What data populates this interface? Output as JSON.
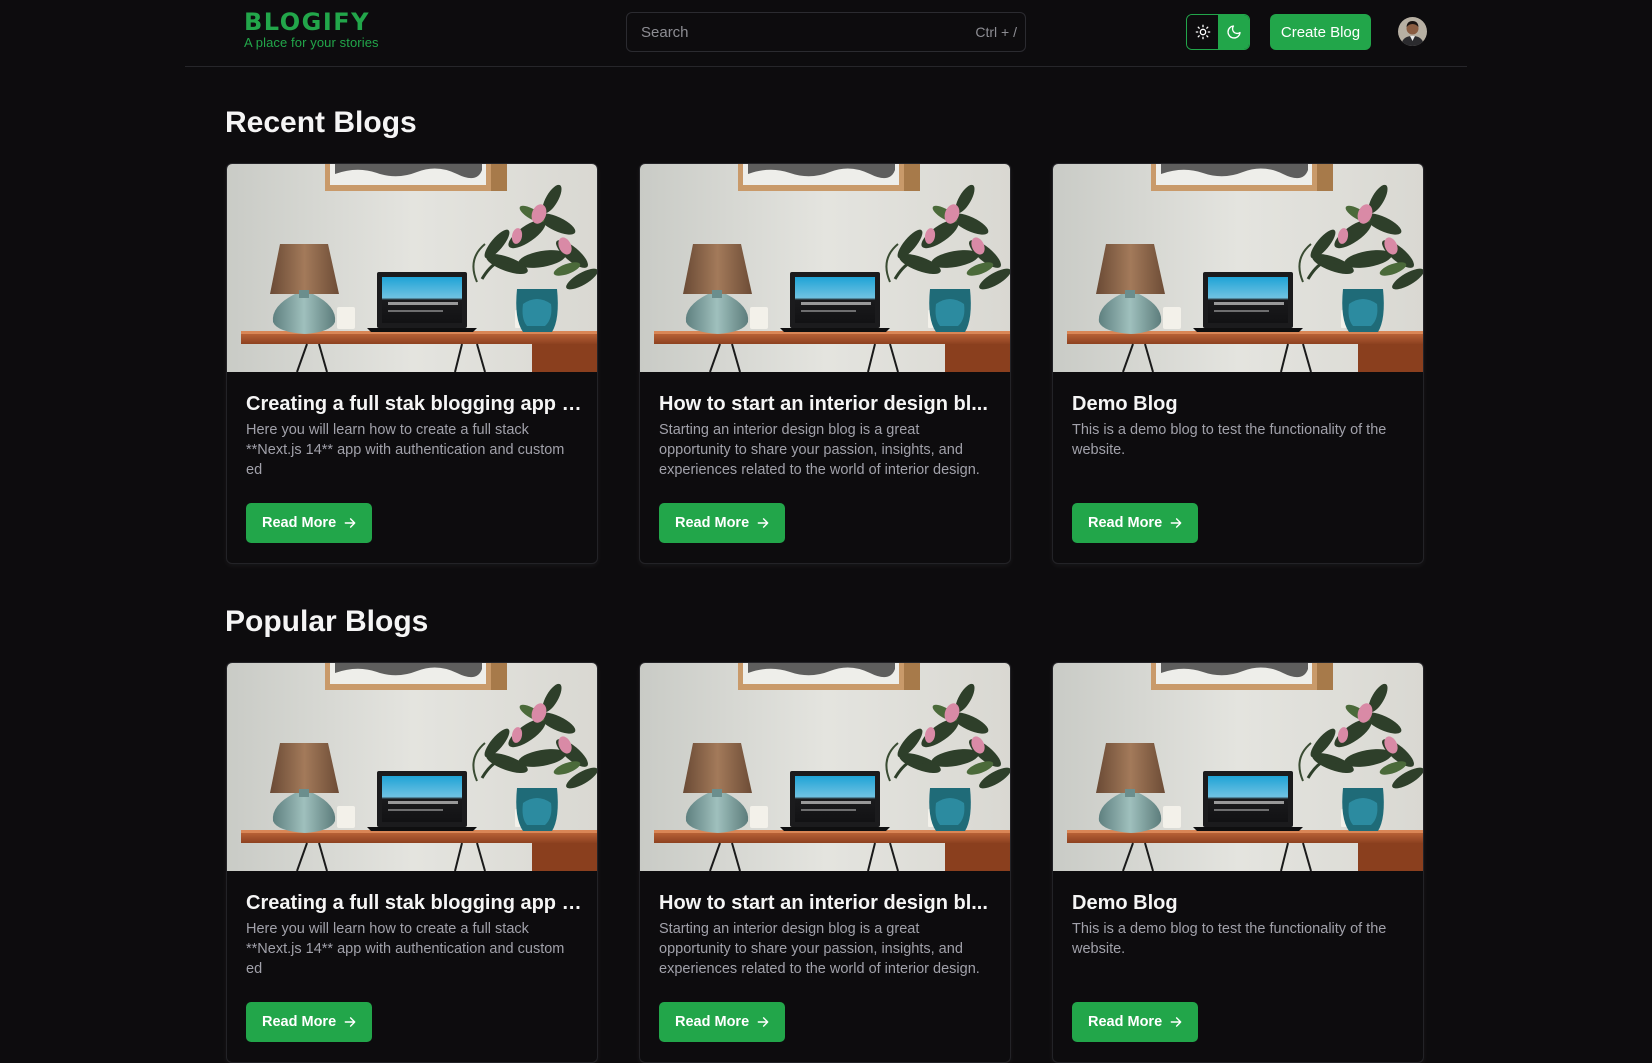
{
  "brand": {
    "name": "BLOGIFY",
    "tagline": "A place for your stories",
    "accent_color": "#22a64a"
  },
  "header": {
    "search": {
      "placeholder": "Search",
      "value": "",
      "shortcut": "Ctrl + /"
    },
    "theme_toggle": {
      "options": [
        {
          "name": "light",
          "icon": "sun-icon",
          "active": false
        },
        {
          "name": "dark",
          "icon": "moon-icon",
          "active": true
        }
      ]
    },
    "create_button_label": "Create Blog",
    "avatar": "user-avatar"
  },
  "sections": {
    "recent": {
      "title": "Recent Blogs",
      "cards": [
        {
          "title": "Creating a full stak blogging app i...",
          "description": "Here you will learn how to create a full stack **Next.js 14** app with authentication and custom ed",
          "button_label": "Read More"
        },
        {
          "title": "How to start an interior design bl...",
          "description": "Starting an interior design blog is a great opportunity to share your passion, insights, and experiences related to the world of interior design.",
          "button_label": "Read More"
        },
        {
          "title": "Demo Blog",
          "description": "This is a demo blog to test the functionality of the website.",
          "button_label": "Read More"
        }
      ]
    },
    "popular": {
      "title": "Popular Blogs",
      "cards": [
        {
          "title": "Creating a full stak blogging app i...",
          "description": "Here you will learn how to create a full stack **Next.js 14** app with authentication and custom ed",
          "button_label": "Read More"
        },
        {
          "title": "How to start an interior design bl...",
          "description": "Starting an interior design blog is a great opportunity to share your passion, insights, and experiences related to the world of interior design.",
          "button_label": "Read More"
        },
        {
          "title": "Demo Blog",
          "description": "This is a demo blog to test the functionality of the website.",
          "button_label": "Read More"
        }
      ]
    }
  }
}
